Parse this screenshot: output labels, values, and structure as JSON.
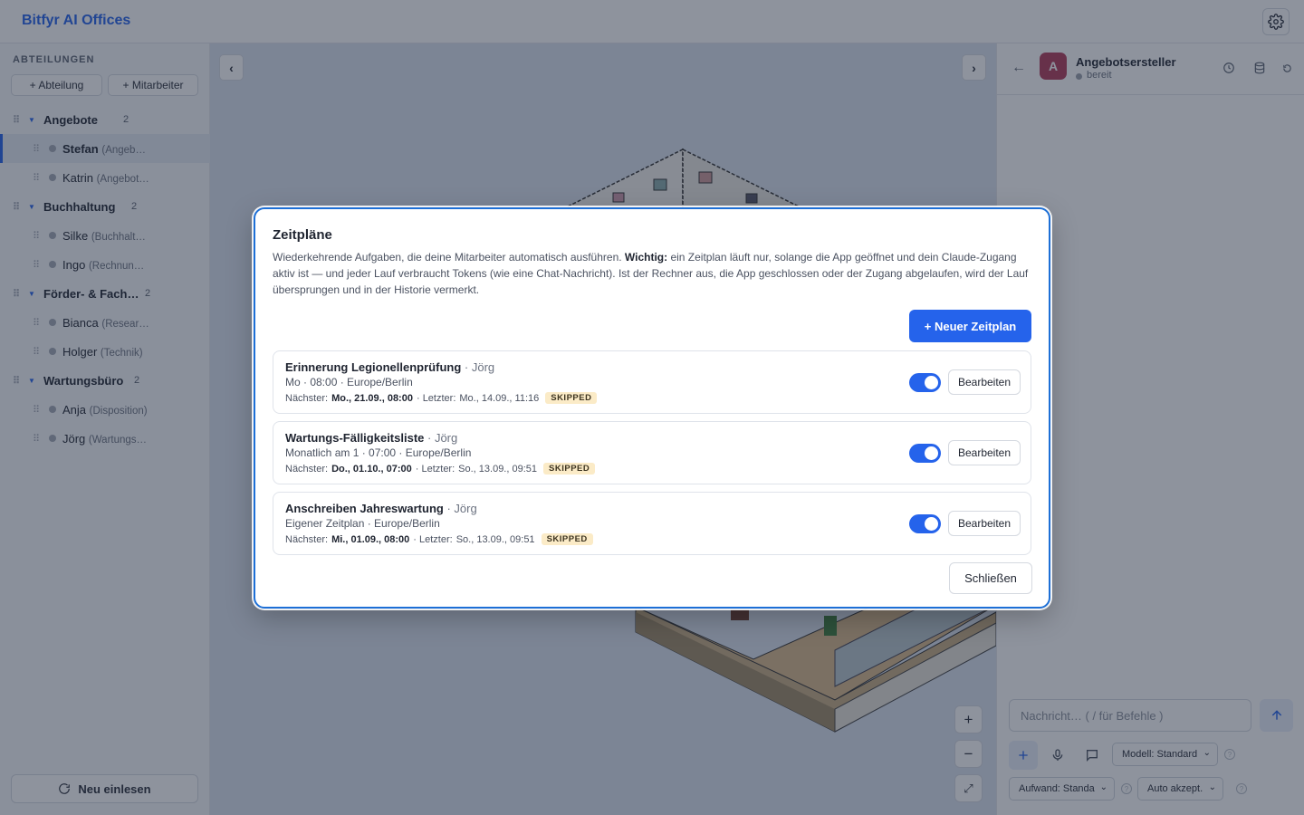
{
  "app": {
    "title": "Bitfyr AI Offices"
  },
  "icons": {
    "settings": "gear-icon",
    "reload": "refresh-icon",
    "history": "clock-icon",
    "database": "database-icon",
    "reset": "undo-icon"
  },
  "colors": {
    "accent": "#2563eb",
    "avatar": "#b03a58",
    "badge_bg": "#fbebc7"
  },
  "sidebar": {
    "title": "ABTEILUNGEN",
    "add_department": "+ Abteilung",
    "add_employee": "+ Mitarbeiter",
    "reload": "Neu einlesen",
    "departments": [
      {
        "name": "Angebote",
        "count": "2",
        "members": [
          {
            "name": "Stefan",
            "role": "(Angeb…",
            "selected": true
          },
          {
            "name": "Katrin",
            "role": "(Angebot…"
          }
        ]
      },
      {
        "name": "Buchhaltung",
        "count": "2",
        "members": [
          {
            "name": "Silke",
            "role": "(Buchhalt…"
          },
          {
            "name": "Ingo",
            "role": "(Rechnun…"
          }
        ]
      },
      {
        "name": "Förder- & Fach…",
        "count": "2",
        "members": [
          {
            "name": "Bianca",
            "role": "(Resear…"
          },
          {
            "name": "Holger",
            "role": "(Technik)"
          }
        ]
      },
      {
        "name": "Wartungsbüro",
        "count": "2",
        "members": [
          {
            "name": "Anja",
            "role": "(Disposition)"
          },
          {
            "name": "Jörg",
            "role": "(Wartungs…"
          }
        ]
      }
    ]
  },
  "canvas": {
    "prev": "‹",
    "next": "›",
    "zoom_in": "+",
    "zoom_out": "−",
    "fit": "⤢"
  },
  "agent": {
    "initial": "A",
    "name": "Angebotsersteller",
    "status": "bereit",
    "back": "←",
    "composer_placeholder": "Nachricht…  ( / für Befehle )",
    "model_select": "Modell: Standard",
    "effort_select": "Aufwand: Standa",
    "accept_select": "Auto akzept."
  },
  "modal": {
    "title": "Zeitpläne",
    "desc_start": "Wiederkehrende Aufgaben, die deine Mitarbeiter automatisch ausführen. ",
    "desc_bold": "Wichtig:",
    "desc_rest": " ein Zeitplan läuft nur, solange die App geöffnet und dein Claude-Zugang aktiv ist — und jeder Lauf verbraucht Tokens (wie eine Chat-Nachricht). Ist der Rechner aus, die App geschlossen oder der Zugang abgelaufen, wird der Lauf übersprungen und in der Historie vermerkt.",
    "new_button": "+ Neuer Zeitplan",
    "edit_label": "Bearbeiten",
    "close_label": "Schließen",
    "next_label": "Nächster:",
    "last_label": "· Letzter:",
    "schedules": [
      {
        "title": "Erinnerung Legionellenprüfung",
        "owner": " · Jörg",
        "cadence": "Mo · 08:00 · Europe/Berlin",
        "next": "Mo., 21.09., 08:00",
        "last": "Mo., 14.09., 11:16",
        "status": "SKIPPED",
        "enabled": true
      },
      {
        "title": "Wartungs-Fälligkeitsliste",
        "owner": " · Jörg",
        "cadence": "Monatlich am 1 · 07:00 · Europe/Berlin",
        "next": "Do., 01.10., 07:00",
        "last": "So., 13.09., 09:51",
        "status": "SKIPPED",
        "enabled": true
      },
      {
        "title": "Anschreiben Jahreswartung",
        "owner": " · Jörg",
        "cadence": "Eigener Zeitplan · Europe/Berlin",
        "next": "Mi., 01.09., 08:00",
        "last": "So., 13.09., 09:51",
        "status": "SKIPPED",
        "enabled": true
      }
    ]
  }
}
